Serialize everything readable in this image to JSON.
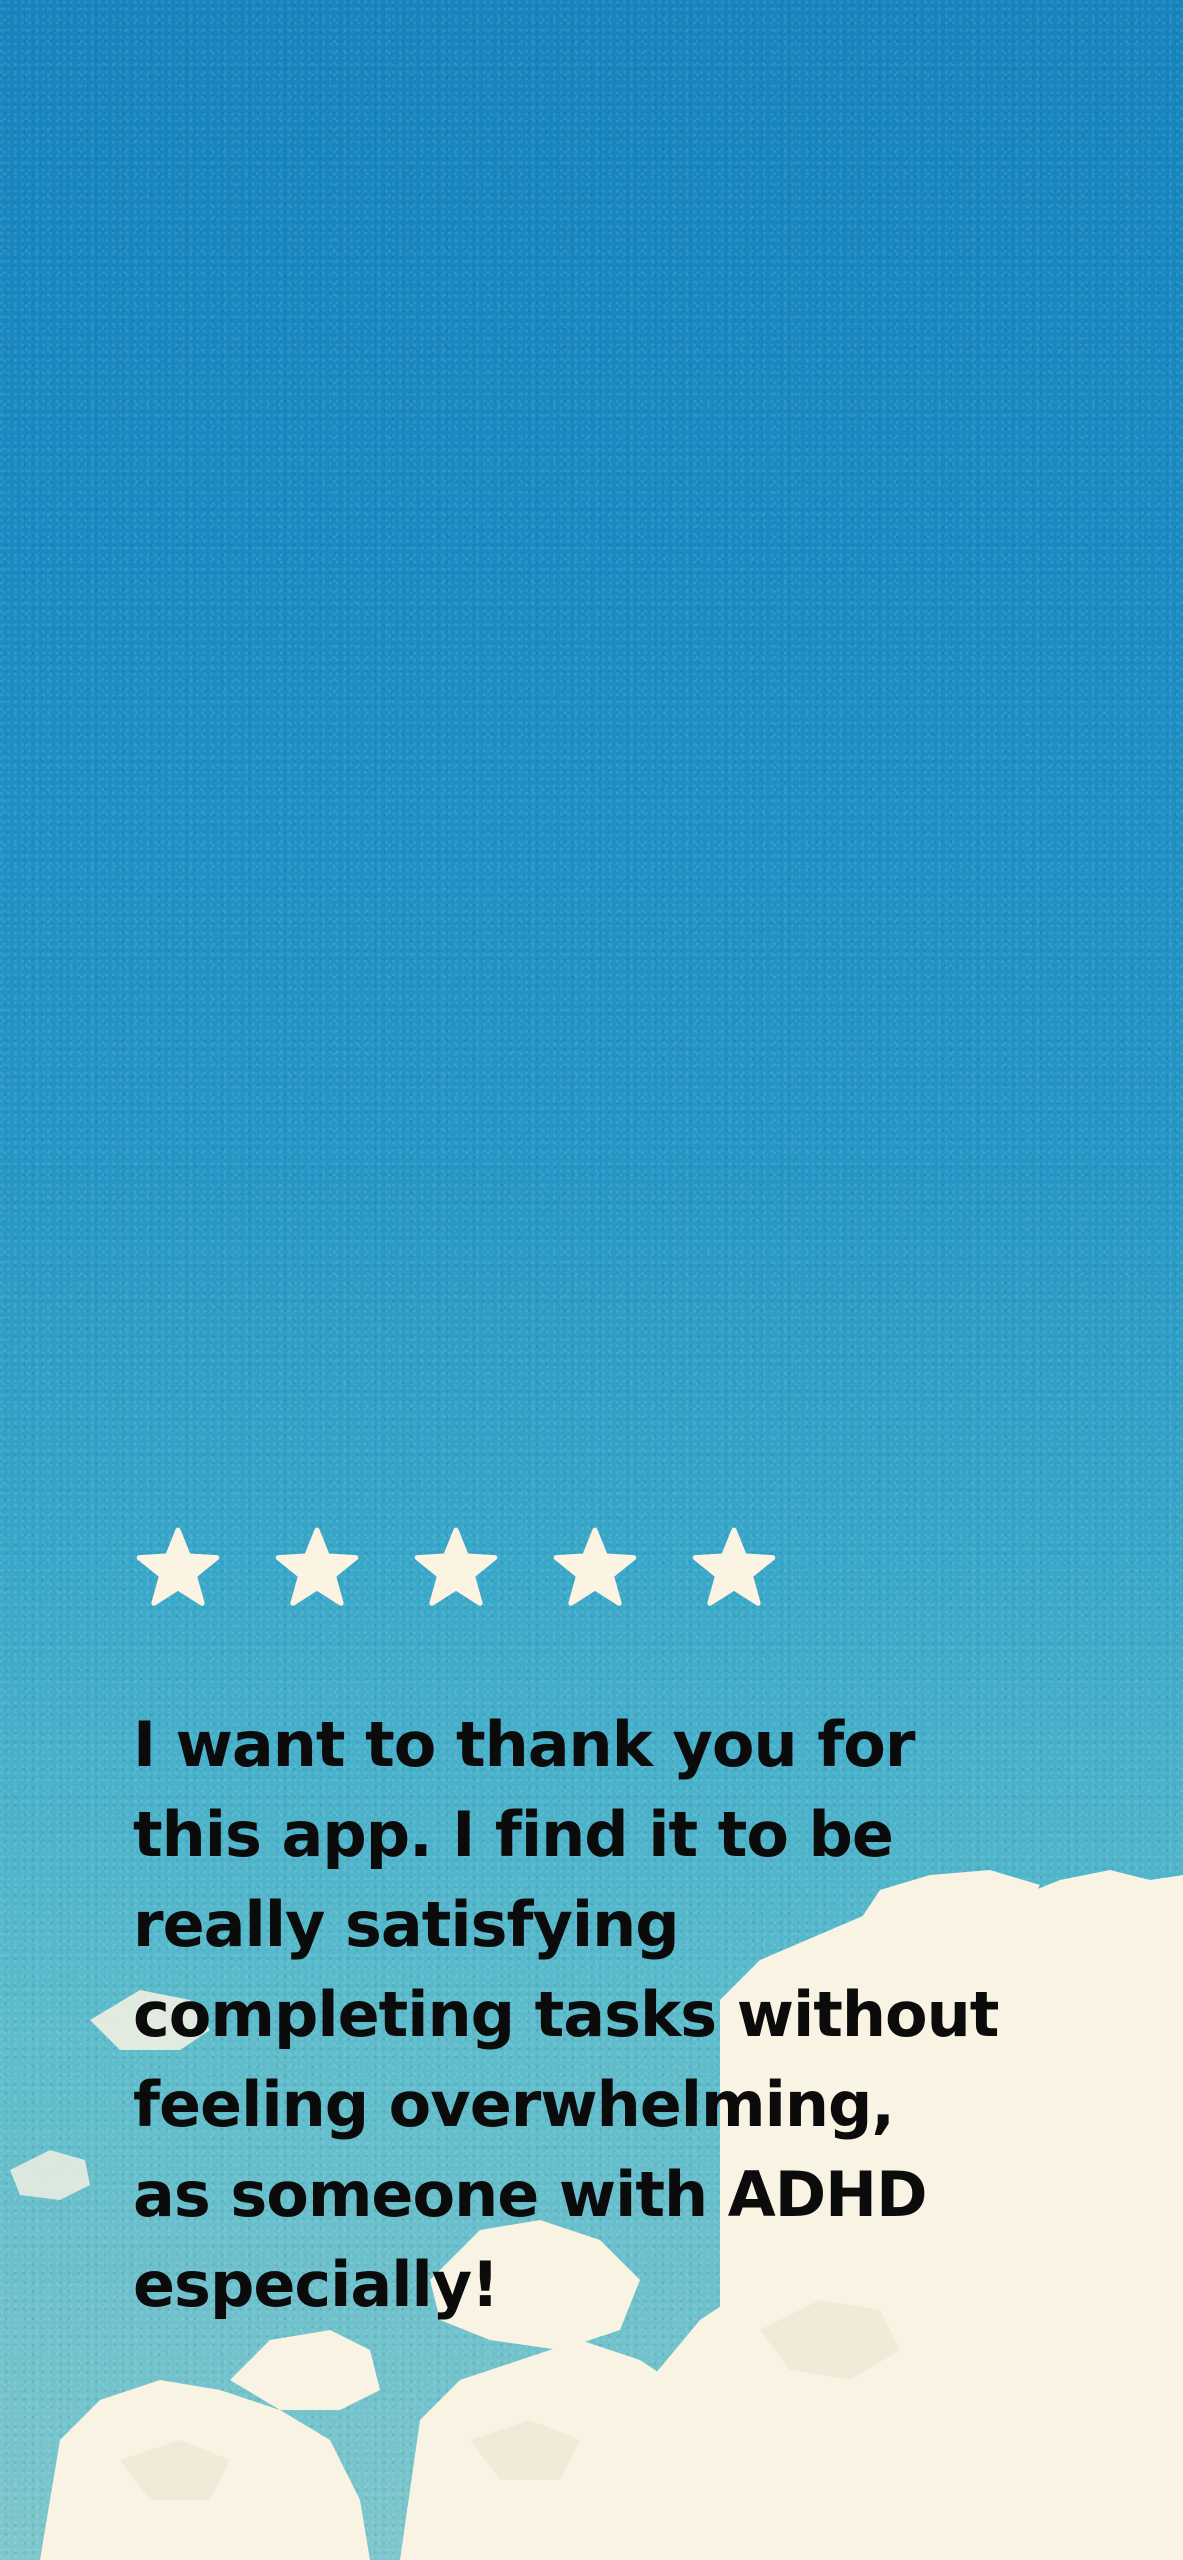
{
  "rating": {
    "value": 5,
    "max": 5,
    "star_color": "#fbf4e2",
    "icon": "star-icon"
  },
  "review": {
    "text": "I  want to thank you for\nthis app. I find it to be\nreally satisfying\ncompleting tasks without\nfeeling overwhelming,\nas someone with ADHD\nespecially!"
  },
  "colors": {
    "sky_top": "#1784bd",
    "sky_bottom": "#7ec6cc",
    "cloud": "#f8f3e3",
    "text": "#0b0b0b"
  }
}
